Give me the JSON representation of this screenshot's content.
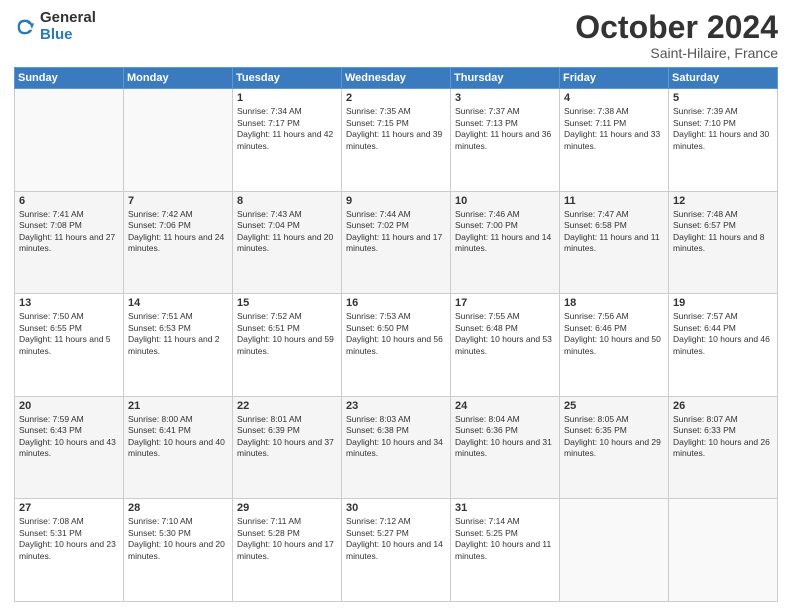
{
  "logo": {
    "general": "General",
    "blue": "Blue"
  },
  "header": {
    "title": "October 2024",
    "subtitle": "Saint-Hilaire, France"
  },
  "weekdays": [
    "Sunday",
    "Monday",
    "Tuesday",
    "Wednesday",
    "Thursday",
    "Friday",
    "Saturday"
  ],
  "weeks": [
    [
      {
        "day": "",
        "info": ""
      },
      {
        "day": "",
        "info": ""
      },
      {
        "day": "1",
        "info": "Sunrise: 7:34 AM\nSunset: 7:17 PM\nDaylight: 11 hours and 42 minutes."
      },
      {
        "day": "2",
        "info": "Sunrise: 7:35 AM\nSunset: 7:15 PM\nDaylight: 11 hours and 39 minutes."
      },
      {
        "day": "3",
        "info": "Sunrise: 7:37 AM\nSunset: 7:13 PM\nDaylight: 11 hours and 36 minutes."
      },
      {
        "day": "4",
        "info": "Sunrise: 7:38 AM\nSunset: 7:11 PM\nDaylight: 11 hours and 33 minutes."
      },
      {
        "day": "5",
        "info": "Sunrise: 7:39 AM\nSunset: 7:10 PM\nDaylight: 11 hours and 30 minutes."
      }
    ],
    [
      {
        "day": "6",
        "info": "Sunrise: 7:41 AM\nSunset: 7:08 PM\nDaylight: 11 hours and 27 minutes."
      },
      {
        "day": "7",
        "info": "Sunrise: 7:42 AM\nSunset: 7:06 PM\nDaylight: 11 hours and 24 minutes."
      },
      {
        "day": "8",
        "info": "Sunrise: 7:43 AM\nSunset: 7:04 PM\nDaylight: 11 hours and 20 minutes."
      },
      {
        "day": "9",
        "info": "Sunrise: 7:44 AM\nSunset: 7:02 PM\nDaylight: 11 hours and 17 minutes."
      },
      {
        "day": "10",
        "info": "Sunrise: 7:46 AM\nSunset: 7:00 PM\nDaylight: 11 hours and 14 minutes."
      },
      {
        "day": "11",
        "info": "Sunrise: 7:47 AM\nSunset: 6:58 PM\nDaylight: 11 hours and 11 minutes."
      },
      {
        "day": "12",
        "info": "Sunrise: 7:48 AM\nSunset: 6:57 PM\nDaylight: 11 hours and 8 minutes."
      }
    ],
    [
      {
        "day": "13",
        "info": "Sunrise: 7:50 AM\nSunset: 6:55 PM\nDaylight: 11 hours and 5 minutes."
      },
      {
        "day": "14",
        "info": "Sunrise: 7:51 AM\nSunset: 6:53 PM\nDaylight: 11 hours and 2 minutes."
      },
      {
        "day": "15",
        "info": "Sunrise: 7:52 AM\nSunset: 6:51 PM\nDaylight: 10 hours and 59 minutes."
      },
      {
        "day": "16",
        "info": "Sunrise: 7:53 AM\nSunset: 6:50 PM\nDaylight: 10 hours and 56 minutes."
      },
      {
        "day": "17",
        "info": "Sunrise: 7:55 AM\nSunset: 6:48 PM\nDaylight: 10 hours and 53 minutes."
      },
      {
        "day": "18",
        "info": "Sunrise: 7:56 AM\nSunset: 6:46 PM\nDaylight: 10 hours and 50 minutes."
      },
      {
        "day": "19",
        "info": "Sunrise: 7:57 AM\nSunset: 6:44 PM\nDaylight: 10 hours and 46 minutes."
      }
    ],
    [
      {
        "day": "20",
        "info": "Sunrise: 7:59 AM\nSunset: 6:43 PM\nDaylight: 10 hours and 43 minutes."
      },
      {
        "day": "21",
        "info": "Sunrise: 8:00 AM\nSunset: 6:41 PM\nDaylight: 10 hours and 40 minutes."
      },
      {
        "day": "22",
        "info": "Sunrise: 8:01 AM\nSunset: 6:39 PM\nDaylight: 10 hours and 37 minutes."
      },
      {
        "day": "23",
        "info": "Sunrise: 8:03 AM\nSunset: 6:38 PM\nDaylight: 10 hours and 34 minutes."
      },
      {
        "day": "24",
        "info": "Sunrise: 8:04 AM\nSunset: 6:36 PM\nDaylight: 10 hours and 31 minutes."
      },
      {
        "day": "25",
        "info": "Sunrise: 8:05 AM\nSunset: 6:35 PM\nDaylight: 10 hours and 29 minutes."
      },
      {
        "day": "26",
        "info": "Sunrise: 8:07 AM\nSunset: 6:33 PM\nDaylight: 10 hours and 26 minutes."
      }
    ],
    [
      {
        "day": "27",
        "info": "Sunrise: 7:08 AM\nSunset: 5:31 PM\nDaylight: 10 hours and 23 minutes."
      },
      {
        "day": "28",
        "info": "Sunrise: 7:10 AM\nSunset: 5:30 PM\nDaylight: 10 hours and 20 minutes."
      },
      {
        "day": "29",
        "info": "Sunrise: 7:11 AM\nSunset: 5:28 PM\nDaylight: 10 hours and 17 minutes."
      },
      {
        "day": "30",
        "info": "Sunrise: 7:12 AM\nSunset: 5:27 PM\nDaylight: 10 hours and 14 minutes."
      },
      {
        "day": "31",
        "info": "Sunrise: 7:14 AM\nSunset: 5:25 PM\nDaylight: 10 hours and 11 minutes."
      },
      {
        "day": "",
        "info": ""
      },
      {
        "day": "",
        "info": ""
      }
    ]
  ]
}
